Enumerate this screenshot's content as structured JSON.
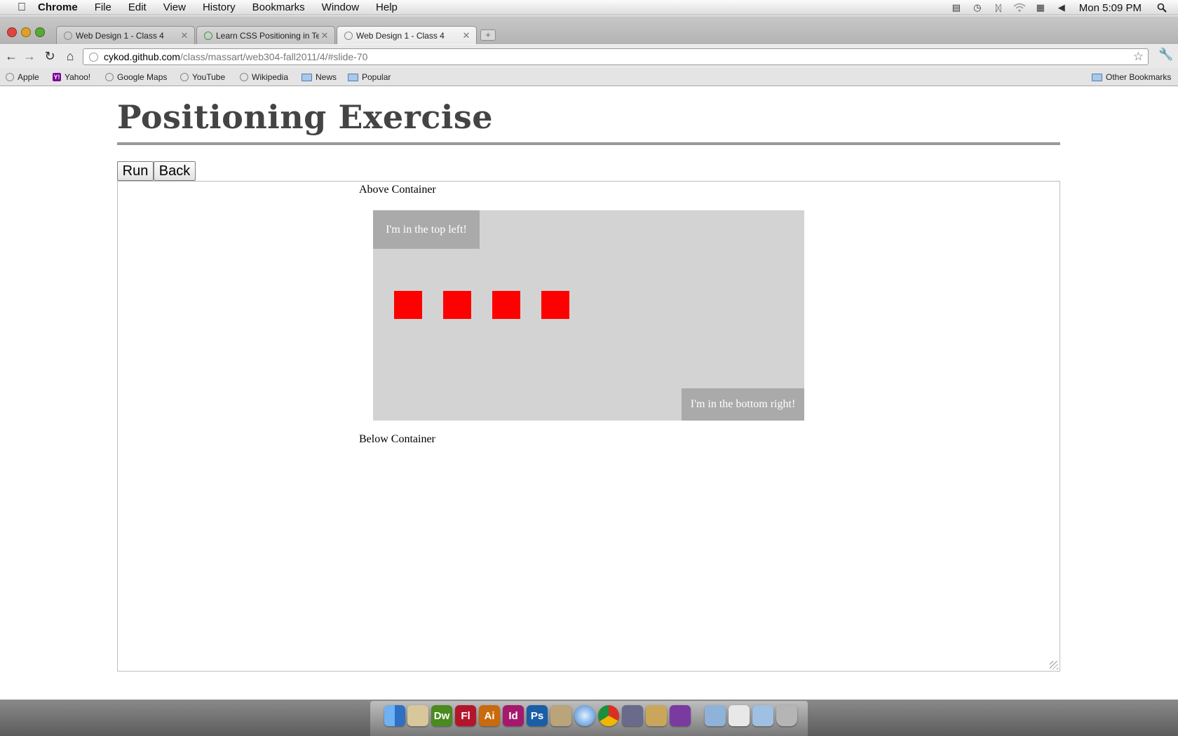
{
  "menubar": {
    "apple": "",
    "app_name": "Chrome",
    "items": [
      "File",
      "Edit",
      "View",
      "History",
      "Bookmarks",
      "Window",
      "Help"
    ],
    "clock": "Mon 5:09 PM"
  },
  "tabs": [
    {
      "label": "Web Design 1 - Class 4"
    },
    {
      "label": "Learn CSS Positioning in Ten"
    },
    {
      "label": "Web Design 1 - Class 4"
    }
  ],
  "omnibox": {
    "host": "cykod.github.com",
    "path": "/class/massart/web304-fall2011/4/#slide-70"
  },
  "bookmarks": {
    "items": [
      "Apple",
      "Yahoo!",
      "Google Maps",
      "YouTube",
      "Wikipedia",
      "News",
      "Popular"
    ],
    "other": "Other Bookmarks"
  },
  "page": {
    "title": "Positioning Exercise",
    "run_label": "Run",
    "back_label": "Back",
    "above": "Above Container",
    "below": "Below Container",
    "top_left": "I'm in the top left!",
    "bottom_right": "I'm in the bottom right!"
  },
  "colors": {
    "container": "#d3d3d3",
    "corner_box": "#aaaaaa",
    "square": "#ff0000"
  },
  "dock": {
    "labels": [
      "Dw",
      "Fl",
      "Ai",
      "Id",
      "Ps"
    ]
  }
}
